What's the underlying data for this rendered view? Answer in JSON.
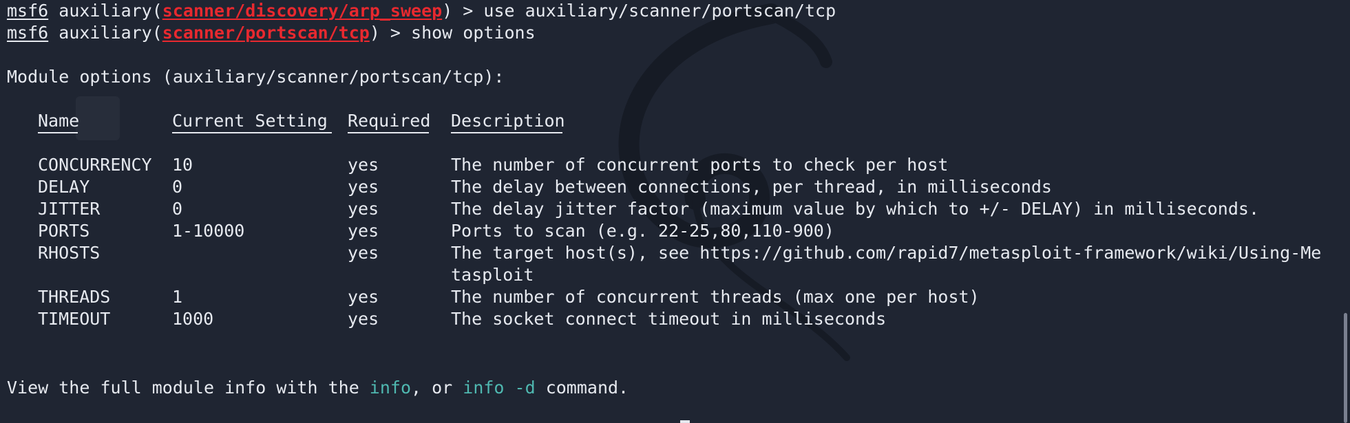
{
  "terminal": {
    "line1": {
      "prompt": "msf6",
      "prefix": " auxiliary(",
      "module": "scanner/discovery/arp_sweep",
      "suffix": ") > use auxiliary/scanner/portscan/tcp"
    },
    "line2": {
      "prompt": "msf6",
      "prefix": " auxiliary(",
      "module": "scanner/portscan/tcp",
      "suffix": ") > show options"
    },
    "module_options_heading": "Module options (auxiliary/scanner/portscan/tcp):",
    "table": {
      "headers": [
        "Name",
        "Current Setting",
        "Required",
        "Description"
      ],
      "rows": [
        {
          "name": "CONCURRENCY",
          "setting": "10",
          "required": "yes",
          "description": "The number of concurrent ports to check per host"
        },
        {
          "name": "DELAY",
          "setting": "0",
          "required": "yes",
          "description": "The delay between connections, per thread, in milliseconds"
        },
        {
          "name": "JITTER",
          "setting": "0",
          "required": "yes",
          "description": "The delay jitter factor (maximum value by which to +/- DELAY) in milliseconds."
        },
        {
          "name": "PORTS",
          "setting": "1-10000",
          "required": "yes",
          "description": "Ports to scan (e.g. 22-25,80,110-900)"
        },
        {
          "name": "RHOSTS",
          "setting": "",
          "required": "yes",
          "description": "The target host(s), see https://github.com/rapid7/metasploit-framework/wiki/Using-Me",
          "description_cont": "tasploit"
        },
        {
          "name": "THREADS",
          "setting": "1",
          "required": "yes",
          "description": "The number of concurrent threads (max one per host)"
        },
        {
          "name": "TIMEOUT",
          "setting": "1000",
          "required": "yes",
          "description": "The socket connect timeout in milliseconds"
        }
      ]
    },
    "footer": {
      "before": "View the full module info with the ",
      "kw1": "info",
      "middle": ", or ",
      "kw2": "info -d",
      "after": " command."
    }
  },
  "colors": {
    "background": "#1f2532",
    "text": "#e6e9ef",
    "module_red": "#e8292f",
    "keyword_teal": "#4fb8b0"
  }
}
